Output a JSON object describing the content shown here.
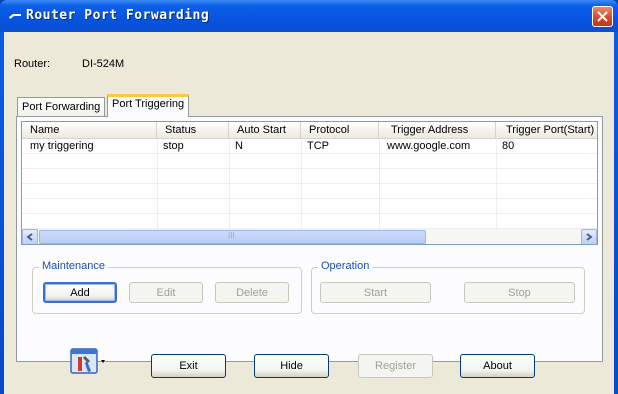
{
  "window": {
    "title": "Router Port Forwarding"
  },
  "router": {
    "label": "Router:",
    "model": "DI-524M"
  },
  "tabs": [
    {
      "label": "Port Forwarding",
      "active": false
    },
    {
      "label": "Port Triggering",
      "active": true
    }
  ],
  "table": {
    "columns": [
      "Name",
      "Status",
      "Auto Start",
      "Protocol",
      "Trigger Address",
      "Trigger Port(Start)"
    ],
    "rows": [
      [
        "my triggering",
        "stop",
        "N",
        "TCP",
        "www.google.com",
        "80"
      ]
    ],
    "scroll_center_glyph": "III"
  },
  "maintenance": {
    "title": "Maintenance",
    "add_label": "Add",
    "edit_label": "Edit",
    "delete_label": "Delete"
  },
  "operation": {
    "title": "Operation",
    "start_label": "Start",
    "stop_label": "Stop"
  },
  "footer": {
    "exit_label": "Exit",
    "hide_label": "Hide",
    "register_label": "Register",
    "about_label": "About",
    "tool_icon": "tools-icon"
  },
  "colors": {
    "titlebar": "#0754dd",
    "tab_active_accent": "#ffc73c",
    "close_button": "#d4502e",
    "group_title": "#1b4fae"
  }
}
